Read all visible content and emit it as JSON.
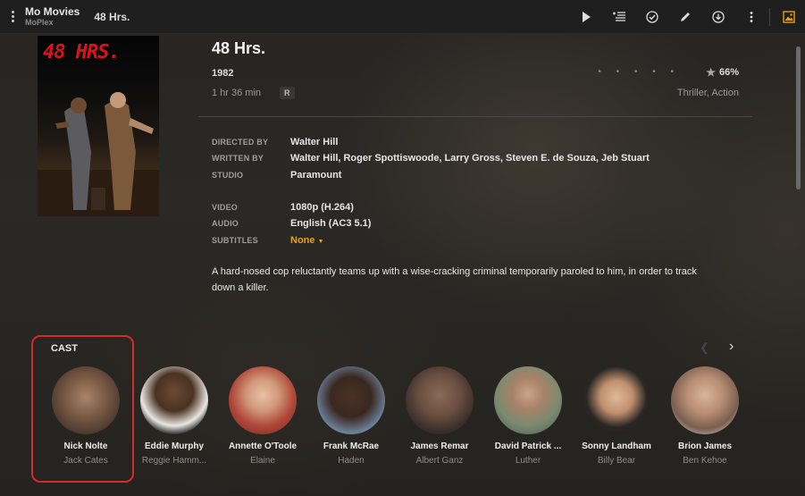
{
  "app": {
    "name": "Mo Movies",
    "sub": "MoPlex",
    "page_title": "48 Hrs."
  },
  "toolbar": {
    "icons": [
      "play-icon",
      "add-to-playlist-icon",
      "mark-watched-icon",
      "edit-icon",
      "download-icon",
      "more-icon",
      "artwork-icon"
    ],
    "accent": "#e5a00d"
  },
  "poster": {
    "title_text": "48 HRS."
  },
  "movie": {
    "title": "48 Hrs.",
    "year": "1982",
    "duration": "1 hr 36 min",
    "content_rating": "R",
    "genres": "Thriller, Action",
    "rating_dots": "• • • • •",
    "rating": "66%"
  },
  "meta": {
    "directed_by_label": "DIRECTED BY",
    "directed_by": "Walter Hill",
    "written_by_label": "WRITTEN BY",
    "written_by": "Walter Hill, Roger Spottiswoode, Larry Gross, Steven E. de Souza, Jeb Stuart",
    "studio_label": "STUDIO",
    "studio": "Paramount",
    "video_label": "VIDEO",
    "video": "1080p (H.264)",
    "audio_label": "AUDIO",
    "audio": "English (AC3 5.1)",
    "subtitles_label": "SUBTITLES",
    "subtitles": "None"
  },
  "summary": "A hard-nosed cop reluctantly teams up with a wise-cracking criminal temporarily paroled to him, in order to track down a killer.",
  "cast": {
    "label": "CAST",
    "members": [
      {
        "name": "Nick Nolte",
        "role": "Jack Cates"
      },
      {
        "name": "Eddie Murphy",
        "role": "Reggie Hamm..."
      },
      {
        "name": "Annette O'Toole",
        "role": "Elaine"
      },
      {
        "name": "Frank McRae",
        "role": "Haden"
      },
      {
        "name": "James Remar",
        "role": "Albert Ganz"
      },
      {
        "name": "David Patrick ...",
        "role": "Luther"
      },
      {
        "name": "Sonny Landham",
        "role": "Billy Bear"
      },
      {
        "name": "Brion James",
        "role": "Ben Kehoe"
      }
    ]
  }
}
